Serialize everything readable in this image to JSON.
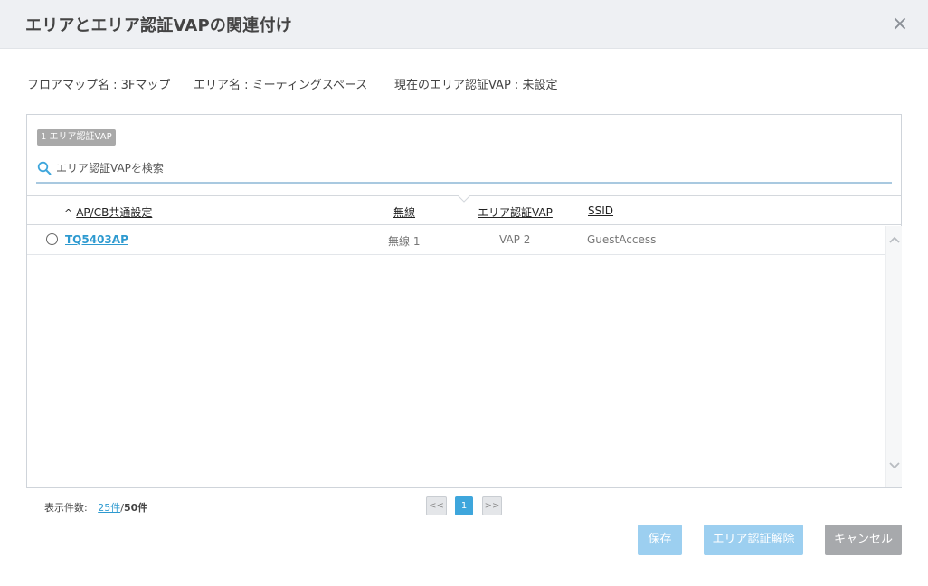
{
  "dialog": {
    "title": "エリアとエリア認証VAPの関連付け"
  },
  "info": {
    "floormap": "フロアマップ名 : 3Fマップ",
    "area": "エリア名 : ミーティングスペース",
    "current_vap": "現在のエリア認証VAP : 未設定"
  },
  "panel": {
    "badge": "1 エリア認証VAP",
    "search_placeholder": "エリア認証VAPを検索"
  },
  "table": {
    "sort_indicator": "^",
    "headers": [
      "AP/CB共通設定",
      "無線",
      "エリア認証VAP",
      "SSID"
    ],
    "rows": [
      {
        "name": "TQ5403AP",
        "radio": "無線 1",
        "vap": "VAP 2",
        "ssid": "GuestAccess"
      }
    ]
  },
  "footer": {
    "count_label": "表示件数:",
    "per_page": "25件",
    "separator": "/",
    "total": "50件"
  },
  "pager": {
    "prev": "<<",
    "current": "1",
    "next": ">>"
  },
  "buttons": {
    "save": "保存",
    "release": "エリア認証解除",
    "cancel": "キャンセル"
  },
  "colors": {
    "accent": "#3ea6dc",
    "link": "#2e9ad0",
    "disabled_primary": "#9ccff0",
    "cancel": "#a7a9ac",
    "header_bg": "#eef0f3"
  },
  "icons": {
    "close": "close-icon",
    "search": "search-icon",
    "sort": "sort-asc-icon",
    "scroll_up": "chevron-up-icon",
    "scroll_down": "chevron-down-icon"
  }
}
